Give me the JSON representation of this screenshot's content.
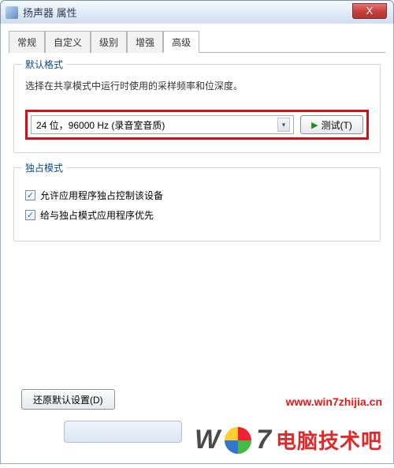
{
  "window": {
    "title": "扬声器 属性",
    "close_label": "X"
  },
  "tabs": [
    {
      "label": "常规"
    },
    {
      "label": "自定义"
    },
    {
      "label": "级别"
    },
    {
      "label": "增强"
    },
    {
      "label": "高级",
      "active": true
    }
  ],
  "default_format": {
    "title": "默认格式",
    "description": "选择在共享模式中运行时使用的采样频率和位深度。",
    "selected": "24 位，96000 Hz (录音室音质)",
    "test_button": "测试(T)",
    "play_icon": "▶"
  },
  "exclusive_mode": {
    "title": "独占模式",
    "options": [
      {
        "label": "允许应用程序独占控制该设备",
        "checked": true
      },
      {
        "label": "给与独占模式应用程序优先",
        "checked": true
      }
    ]
  },
  "restore_defaults": "还原默认设置(D)",
  "watermark_url": "www.win7zhijia.cn",
  "watermark_brand_prefix": "W",
  "watermark_brand_suffix": "7",
  "watermark_site": "电脑技术吧",
  "icons": {
    "dropdown_arrow": "▾",
    "check": "✓"
  }
}
